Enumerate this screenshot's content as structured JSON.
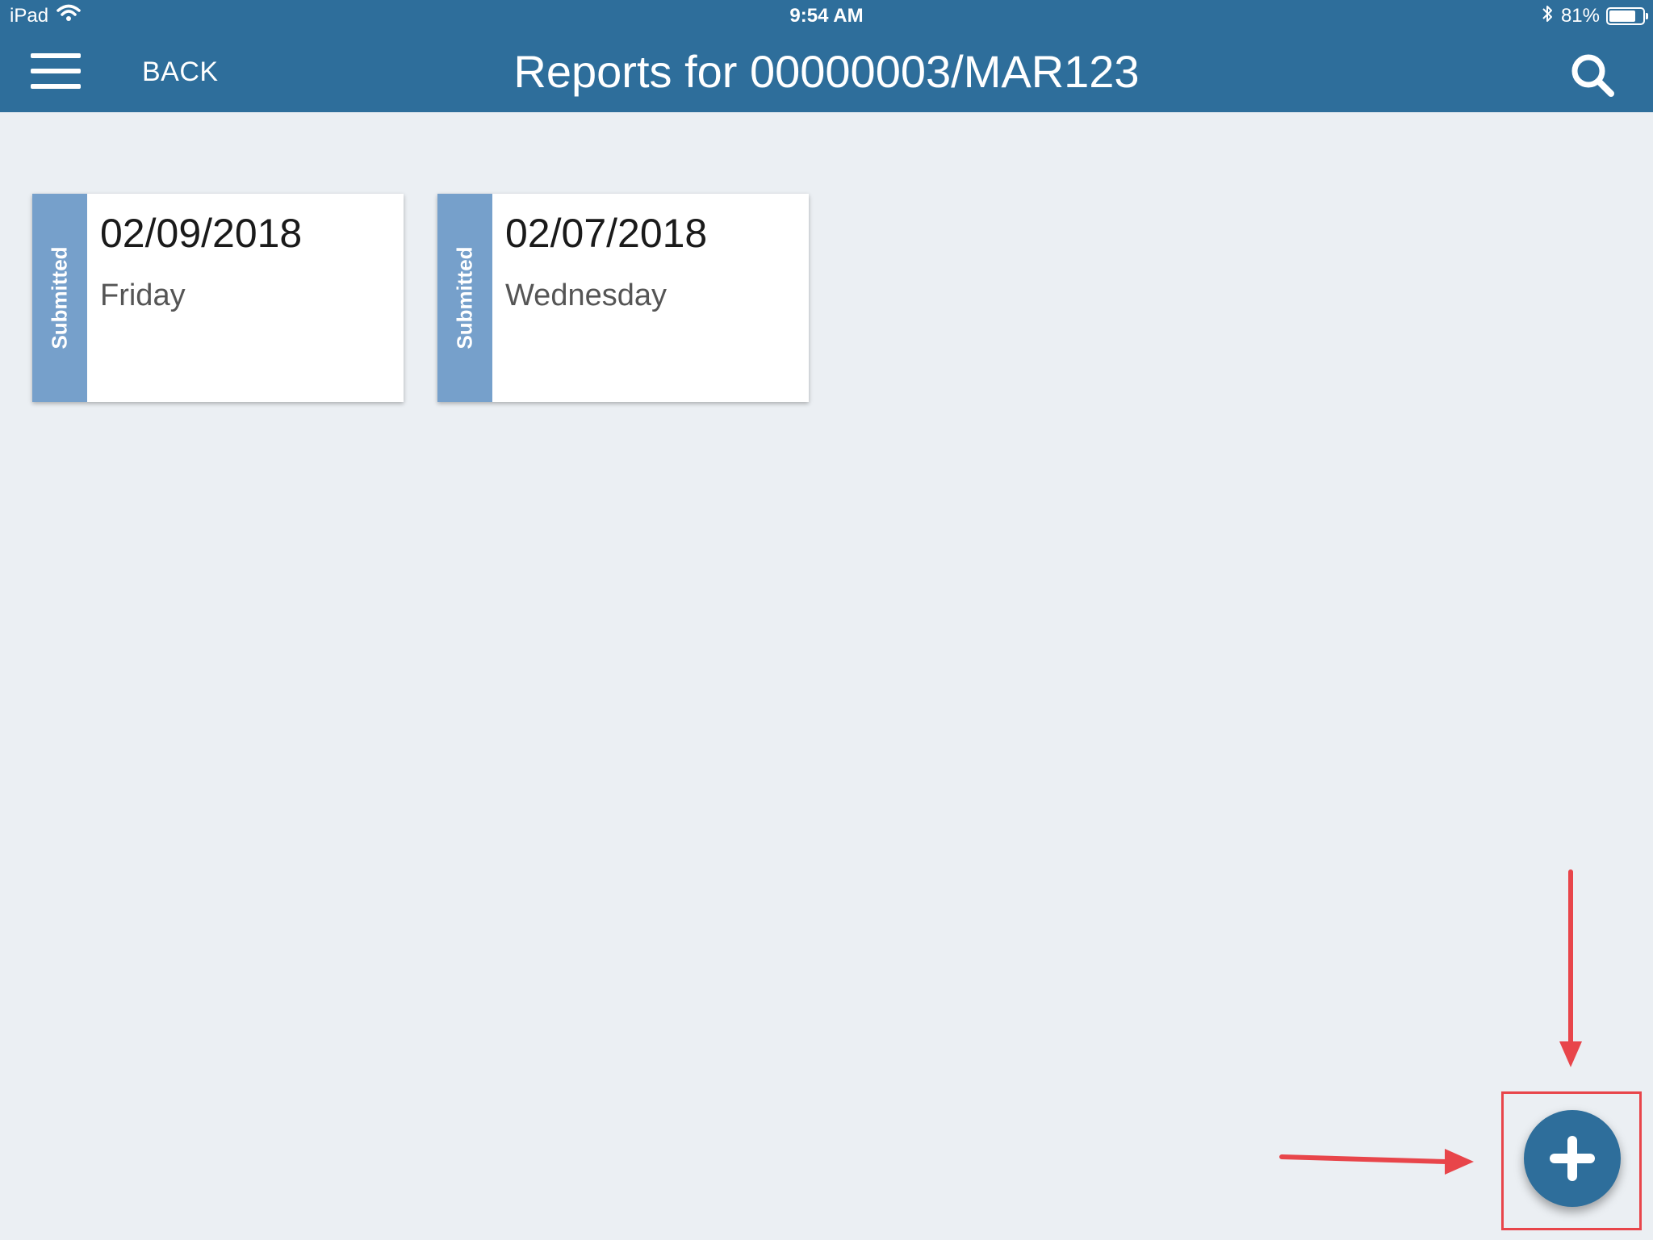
{
  "status_bar": {
    "carrier": "iPad",
    "time": "9:54 AM",
    "battery_text": "81%",
    "battery_level": 0.81
  },
  "header": {
    "back_label": "BACK",
    "title": "Reports for 00000003/MAR123",
    "background_color": "#2e6e9b"
  },
  "reports": [
    {
      "status": "Submitted",
      "date": "02/09/2018",
      "weekday": "Friday"
    },
    {
      "status": "Submitted",
      "date": "02/07/2018",
      "weekday": "Wednesday"
    }
  ],
  "colors": {
    "status_stripe": "#76a0cb",
    "page_background": "#ebeff3",
    "annotation": "#e8454a"
  },
  "icons": {
    "menu": "hamburger-menu-icon",
    "search": "search-icon",
    "add": "plus-icon"
  }
}
